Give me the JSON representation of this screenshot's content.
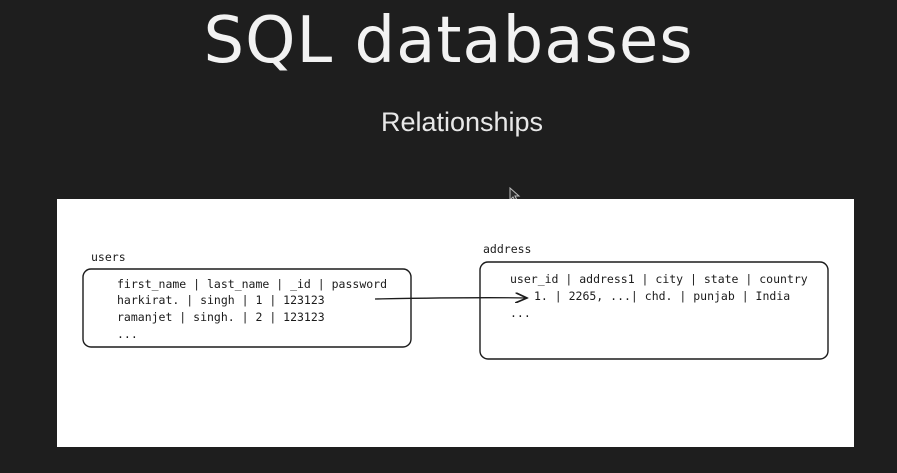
{
  "slide": {
    "title": "SQL databases",
    "subtitle": "Relationships"
  },
  "diagram": {
    "users_table": {
      "name": "users",
      "header": "first_name | last_name | _id | password",
      "rows": [
        "harkirat.  |    singh    | 1    | 123123",
        "ramanjet   |    singh.   | 2    | 123123"
      ],
      "more": "..."
    },
    "address_table": {
      "name": "address",
      "header": "user_id | address1 |   city  | state | country",
      "rows": [
        "1.   |  2265, ...|   chd.  | punjab | India"
      ],
      "more": "..."
    }
  },
  "colors": {
    "background": "#1e1e1e",
    "board": "#ffffff",
    "ink": "#1b1b1b"
  },
  "icons": {
    "cursor": "mouse-pointer-icon"
  }
}
